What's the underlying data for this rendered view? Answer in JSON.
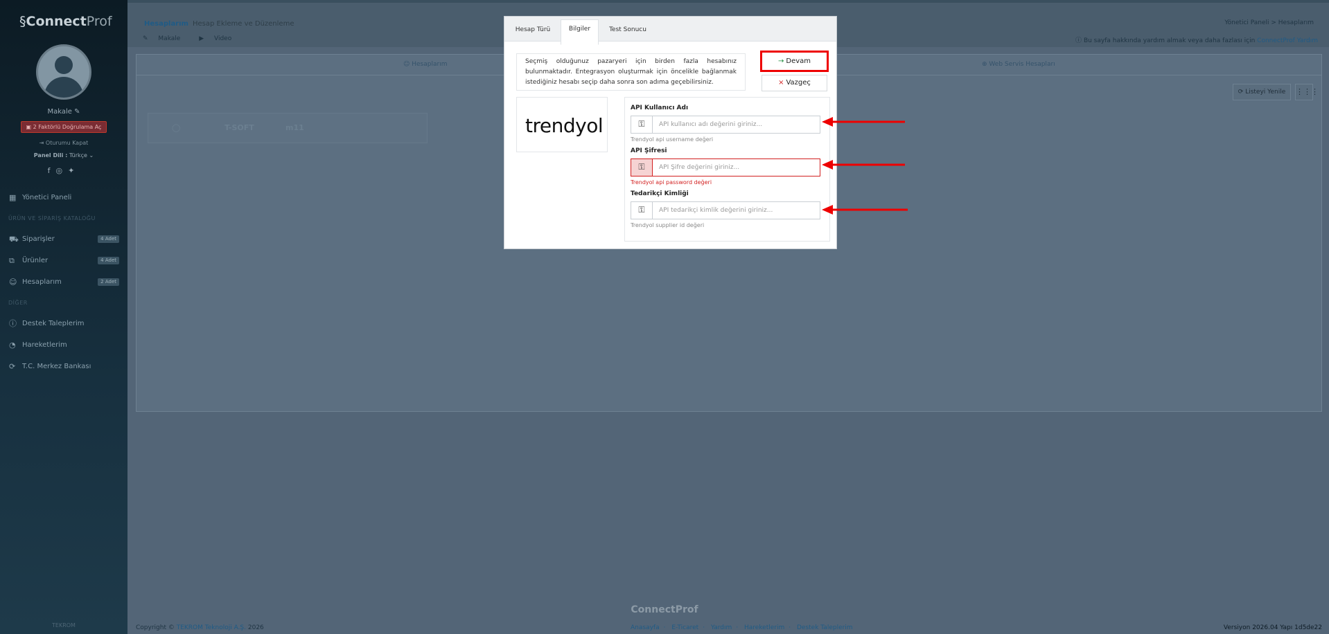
{
  "sidebar": {
    "logo_bold": "Connect",
    "logo_light": "Prof",
    "user_name": "Makale",
    "twofa_label": "2 Faktörlü Doğrulama Aç",
    "logout_label": "Oturumu Kapat",
    "lang_label": "Panel Dili :",
    "lang_value": "Türkçe",
    "nav": [
      {
        "label": "Yönetici Paneli",
        "icon": "dashboard-icon"
      },
      {
        "label": "Siparişler",
        "icon": "cart-icon",
        "badge": "4 Adet"
      },
      {
        "label": "Ürünler",
        "icon": "box-icon",
        "badge": "4 Adet"
      },
      {
        "label": "Hesaplarım",
        "icon": "users-icon",
        "badge": "2 Adet"
      },
      {
        "label": "Destek Taleplerim",
        "icon": "support-icon"
      },
      {
        "label": "Hareketlerim",
        "icon": "chart-icon"
      },
      {
        "label": "T.C. Merkez Bankası",
        "icon": "currency-icon"
      }
    ],
    "section_products": "ÜRÜN VE SİPARİŞ KATALOĞU",
    "section_other": "DİĞER",
    "footer": "TEKROM"
  },
  "header": {
    "title": "Hesaplarım",
    "subtitle": "Hesap Ekleme ve Düzenleme",
    "breadcrumb": "Yönetici Paneli  >  Hesaplarım",
    "link_article": "Makale",
    "link_video": "Video",
    "help_text": "Bu sayfa hakkında yardım almak veya daha fazlası için",
    "help_link": "ConnectProf Yardım"
  },
  "panel": {
    "tab_accounts": "Hesaplarım",
    "tab_webservice": "Web Servis Hesapları",
    "refresh_label": "Listeyi Yenile",
    "strip_logos": [
      "T-SOFT",
      "m11"
    ]
  },
  "modal": {
    "tabs": [
      "Hesap Türü",
      "Bilgiler",
      "Test Sonucu"
    ],
    "active_tab": "Bilgiler",
    "info_text": "Seçmiş olduğunuz pazaryeri için birden fazla hesabınız bulunmaktadır. Entegrasyon oluşturmak için öncelikle bağlanmak istediğiniz hesabı seçip daha sonra son adıma geçebilirsiniz.",
    "continue_label": "Devam",
    "cancel_label": "Vazgeç",
    "logo_text": "trendyol",
    "fields": [
      {
        "label": "API Kullanıcı Adı",
        "placeholder": "API kullanıcı adı değerini giriniz...",
        "help": "Trendyol api username değeri",
        "error": false
      },
      {
        "label": "API Şifresi",
        "placeholder": "API Şifre değerini giriniz...",
        "help": "Trendyol api password değeri",
        "error": true
      },
      {
        "label": "Tedarikçi Kimliği",
        "placeholder": "API tedarikçi kimlik değerini giriniz...",
        "help": "Trendyol supplier id değeri",
        "error": false
      }
    ]
  },
  "footer": {
    "brand": "ConnectProf",
    "copyright_prefix": "Copyright ©",
    "copyright_company": "TEKROM Teknoloji A.Ş.",
    "copyright_year": "2026",
    "links": [
      "Anasayfa",
      "E-Ticaret",
      "Yardım",
      "Hareketlerim",
      "Destek Taleplerim"
    ],
    "version": "Versiyon 2026.04 Yapı 1d5de22"
  },
  "colors": {
    "accent": "#1f5b86",
    "danger": "#d21f1f",
    "annotation_red": "#ee0000"
  }
}
